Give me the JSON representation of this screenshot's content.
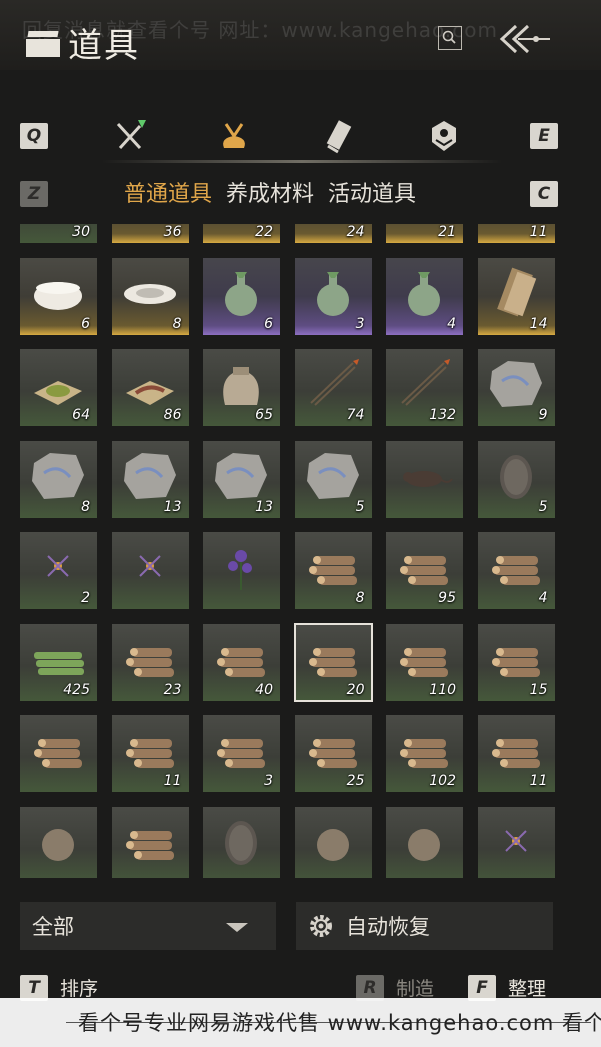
{
  "header": {
    "title": "道具",
    "watermark": "回复消息就查看个号  网址：www.kangehao.com"
  },
  "tabs": {
    "left_key": "Q",
    "right_key": "E",
    "icons": [
      "weapon-icon",
      "item-bag-icon",
      "scroll-icon",
      "badge-icon"
    ],
    "active_index": 1
  },
  "subtabs": {
    "left_key": "Z",
    "right_key": "C",
    "items": [
      "普通道具",
      "养成材料",
      "活动道具"
    ],
    "active": "普通道具"
  },
  "grid": {
    "items": [
      {
        "name": "wine-jar-item",
        "count": "30",
        "rarity": "green"
      },
      {
        "name": "white-bowl-item",
        "count": "36",
        "rarity": "gold"
      },
      {
        "name": "flower-bowl-item",
        "count": "22",
        "rarity": "gold"
      },
      {
        "name": "painted-bowl-item",
        "count": "24",
        "rarity": "gold"
      },
      {
        "name": "rooster-bowl-item",
        "count": "21",
        "rarity": "gold"
      },
      {
        "name": "porcelain-bowl-item",
        "count": "11",
        "rarity": "gold"
      },
      {
        "name": "covered-bowl-item",
        "count": "6",
        "rarity": "gold"
      },
      {
        "name": "dish-item",
        "count": "8",
        "rarity": "gold"
      },
      {
        "name": "celadon-vase-item",
        "count": "6",
        "rarity": "purple"
      },
      {
        "name": "celadon-vase-item",
        "count": "3",
        "rarity": "purple"
      },
      {
        "name": "celadon-vase-item",
        "count": "4",
        "rarity": "purple"
      },
      {
        "name": "book-scroll-item",
        "count": "14",
        "rarity": "gold"
      },
      {
        "name": "herb-powder-item",
        "count": "64",
        "rarity": "green"
      },
      {
        "name": "worm-item",
        "count": "86",
        "rarity": "green"
      },
      {
        "name": "cloth-sack-item",
        "count": "65",
        "rarity": "green"
      },
      {
        "name": "arrow-item",
        "count": "74",
        "rarity": "green"
      },
      {
        "name": "spear-arrow-item",
        "count": "132",
        "rarity": "green"
      },
      {
        "name": "fossil-stone-item",
        "count": "9",
        "rarity": "green"
      },
      {
        "name": "painted-stone-item",
        "count": "8",
        "rarity": "green"
      },
      {
        "name": "painted-stone-item",
        "count": "13",
        "rarity": "green"
      },
      {
        "name": "painted-stone-item",
        "count": "13",
        "rarity": "green"
      },
      {
        "name": "painted-stone-item",
        "count": "5",
        "rarity": "green"
      },
      {
        "name": "rat-item",
        "count": "",
        "rarity": "green"
      },
      {
        "name": "ore-item",
        "count": "5",
        "rarity": "green"
      },
      {
        "name": "firefly-item",
        "count": "2",
        "rarity": "green"
      },
      {
        "name": "butterfly-item",
        "count": "",
        "rarity": "green"
      },
      {
        "name": "purple-flower-item",
        "count": "",
        "rarity": "green"
      },
      {
        "name": "log-pile-item",
        "count": "8",
        "rarity": "green"
      },
      {
        "name": "log-pile-item",
        "count": "95",
        "rarity": "green"
      },
      {
        "name": "log-pile-item",
        "count": "4",
        "rarity": "green"
      },
      {
        "name": "bamboo-bundle-item",
        "count": "425",
        "rarity": "green"
      },
      {
        "name": "log-pile-item",
        "count": "23",
        "rarity": "green"
      },
      {
        "name": "log-pile-item",
        "count": "40",
        "rarity": "green"
      },
      {
        "name": "log-pile-item",
        "count": "20",
        "rarity": "green",
        "selected": true
      },
      {
        "name": "log-pile-item",
        "count": "110",
        "rarity": "green"
      },
      {
        "name": "log-pile-item",
        "count": "15",
        "rarity": "green"
      },
      {
        "name": "log-pile-item",
        "count": "",
        "rarity": "green"
      },
      {
        "name": "log-pile-item",
        "count": "11",
        "rarity": "green"
      },
      {
        "name": "log-pile-item",
        "count": "3",
        "rarity": "green"
      },
      {
        "name": "log-pile-item",
        "count": "25",
        "rarity": "green"
      },
      {
        "name": "log-pile-item",
        "count": "102",
        "rarity": "green"
      },
      {
        "name": "log-pile-item",
        "count": "11",
        "rarity": "green"
      },
      {
        "name": "root-item",
        "count": "",
        "rarity": "green"
      },
      {
        "name": "log-pile-item",
        "count": "",
        "rarity": "green"
      },
      {
        "name": "rock-item",
        "count": "",
        "rarity": "green"
      },
      {
        "name": "feather-item",
        "count": "",
        "rarity": "green"
      },
      {
        "name": "shell-item",
        "count": "",
        "rarity": "green"
      },
      {
        "name": "cricket-item",
        "count": "",
        "rarity": "green"
      }
    ]
  },
  "filter": {
    "label": "全部"
  },
  "auto_restore": {
    "label": "自动恢复"
  },
  "footer": {
    "sort_key": "T",
    "sort_label": "排序",
    "craft_key": "R",
    "craft_label": "制造",
    "organize_key": "F",
    "organize_label": "整理"
  },
  "bottom_watermark": "看个号专业网易游戏代售  www.kangehao.com  看个号",
  "colors": {
    "accent": "#e0a64a",
    "gold_rarity": "#d7aa42",
    "purple_rarity": "#8d6fc2",
    "background": "#1b1b1a"
  }
}
